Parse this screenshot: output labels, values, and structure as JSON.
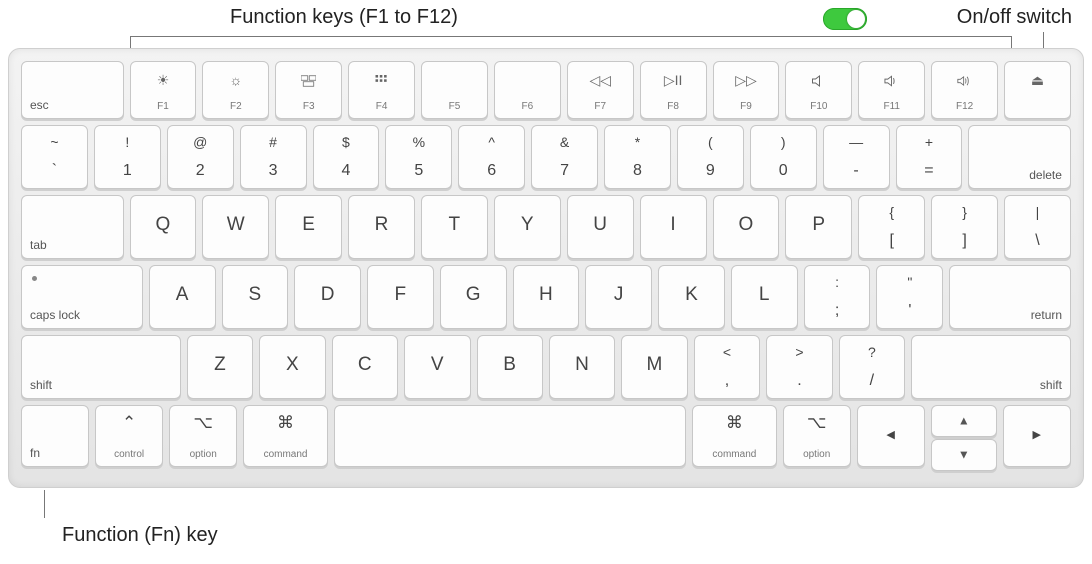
{
  "callouts": {
    "fn_keys": "Function keys (F1 to F12)",
    "switch": "On/off switch",
    "fn_key": "Function (Fn) key"
  },
  "switch": {
    "on": true
  },
  "rows": {
    "fn": {
      "esc": "esc",
      "keys": [
        {
          "f": "F1",
          "icon": "brightness-down"
        },
        {
          "f": "F2",
          "icon": "brightness-up"
        },
        {
          "f": "F3",
          "icon": "mission-control"
        },
        {
          "f": "F4",
          "icon": "launchpad"
        },
        {
          "f": "F5",
          "icon": ""
        },
        {
          "f": "F6",
          "icon": ""
        },
        {
          "f": "F7",
          "icon": "rewind"
        },
        {
          "f": "F8",
          "icon": "play-pause"
        },
        {
          "f": "F9",
          "icon": "forward"
        },
        {
          "f": "F10",
          "icon": "mute"
        },
        {
          "f": "F11",
          "icon": "vol-down"
        },
        {
          "f": "F12",
          "icon": "vol-up"
        }
      ],
      "eject": "⏏"
    },
    "num": {
      "keys": [
        {
          "t": "~",
          "b": "`"
        },
        {
          "t": "!",
          "b": "1"
        },
        {
          "t": "@",
          "b": "2"
        },
        {
          "t": "#",
          "b": "3"
        },
        {
          "t": "$",
          "b": "4"
        },
        {
          "t": "%",
          "b": "5"
        },
        {
          "t": "^",
          "b": "6"
        },
        {
          "t": "&",
          "b": "7"
        },
        {
          "t": "*",
          "b": "8"
        },
        {
          "t": "(",
          "b": "9"
        },
        {
          "t": ")",
          "b": "0"
        },
        {
          "t": "—",
          "b": "-"
        },
        {
          "t": "+",
          "b": "="
        }
      ],
      "delete": "delete"
    },
    "q": {
      "tab": "tab",
      "keys": [
        "Q",
        "W",
        "E",
        "R",
        "T",
        "Y",
        "U",
        "I",
        "O",
        "P"
      ],
      "br1": {
        "t": "{",
        "b": "["
      },
      "br2": {
        "t": "}",
        "b": "]"
      },
      "bs": {
        "t": "|",
        "b": "\\"
      }
    },
    "a": {
      "caps": "caps lock",
      "keys": [
        "A",
        "S",
        "D",
        "F",
        "G",
        "H",
        "J",
        "K",
        "L"
      ],
      "sc": {
        "t": ":",
        "b": ";"
      },
      "qt": {
        "t": "\"",
        "b": "'"
      },
      "return": "return"
    },
    "z": {
      "shiftL": "shift",
      "keys": [
        "Z",
        "X",
        "C",
        "V",
        "B",
        "N",
        "M"
      ],
      "cm": {
        "t": "<",
        "b": ","
      },
      "pd": {
        "t": ">",
        "b": "."
      },
      "sl": {
        "t": "?",
        "b": "/"
      },
      "shiftR": "shift"
    },
    "bot": {
      "fn": "fn",
      "ctrl": {
        "sym": "⌃",
        "lbl": "control"
      },
      "optL": {
        "sym": "⌥",
        "lbl": "option"
      },
      "cmdL": {
        "sym": "⌘",
        "lbl": "command"
      },
      "cmdR": {
        "sym": "⌘",
        "lbl": "command"
      },
      "optR": {
        "sym": "⌥",
        "lbl": "option"
      },
      "arrows": {
        "l": "◀",
        "u": "▲",
        "d": "▼",
        "r": "▶"
      }
    }
  }
}
